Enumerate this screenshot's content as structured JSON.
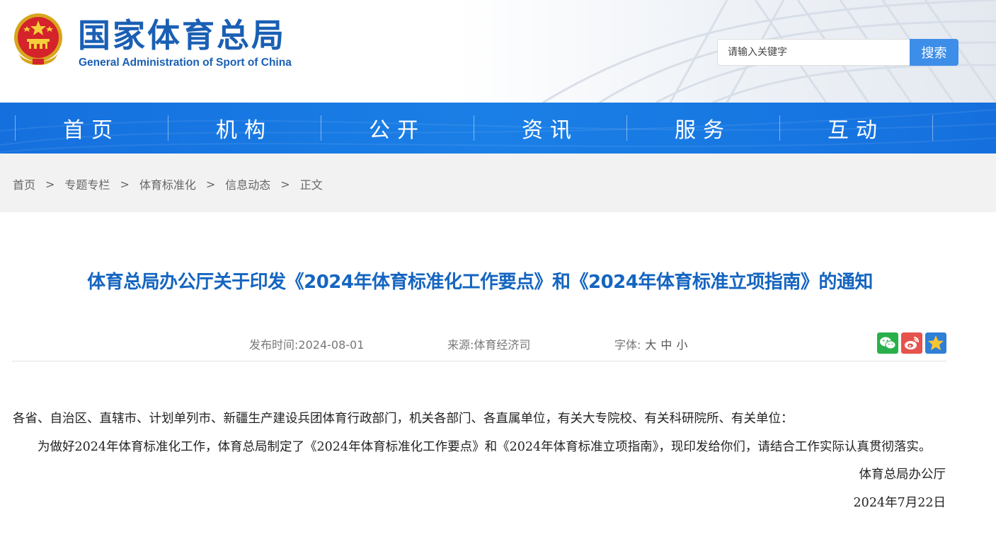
{
  "header": {
    "site_title": "国家体育总局",
    "site_subtitle": "General Administration of Sport of China",
    "search_placeholder": "请输入关键字",
    "search_button": "搜索"
  },
  "nav": {
    "items": [
      {
        "label": "首页"
      },
      {
        "label": "机构"
      },
      {
        "label": "公开"
      },
      {
        "label": "资讯"
      },
      {
        "label": "服务"
      },
      {
        "label": "互动"
      }
    ]
  },
  "breadcrumb": {
    "items": [
      "首页",
      "专题专栏",
      "体育标准化",
      "信息动态",
      "正文"
    ],
    "separator": ">"
  },
  "article": {
    "title": "体育总局办公厅关于印发《2024年体育标准化工作要点》和《2024年体育标准立项指南》的通知",
    "publish_label": "发布时间:",
    "publish_date": "2024-08-01",
    "source_label": "来源:",
    "source": "体育经济司",
    "font_label": "字体:",
    "font_large": "大",
    "font_medium": "中",
    "font_small": "小",
    "paragraph_1": "各省、自治区、直辖市、计划单列市、新疆生产建设兵团体育行政部门，机关各部门、各直属单位，有关大专院校、有关科研院所、有关单位：",
    "paragraph_2": "为做好2024年体育标准化工作，体育总局制定了《2024年体育标准化工作要点》和《2024年体育标准立项指南》，现印发给你们，请结合工作实际认真贯彻落实。",
    "signature": "体育总局办公厅",
    "date": "2024年7月22日"
  },
  "share": {
    "icons": [
      "wechat-icon",
      "weibo-icon",
      "favorite-icon"
    ]
  },
  "colors": {
    "brand_blue": "#1a5fb4",
    "nav_blue": "#1a7fe6",
    "title_blue": "#1565c0",
    "search_button": "#3d8ee8",
    "wechat_green": "#2ab04b",
    "weibo_red": "#e6524c",
    "favorite_blue": "#2f7fd6"
  }
}
